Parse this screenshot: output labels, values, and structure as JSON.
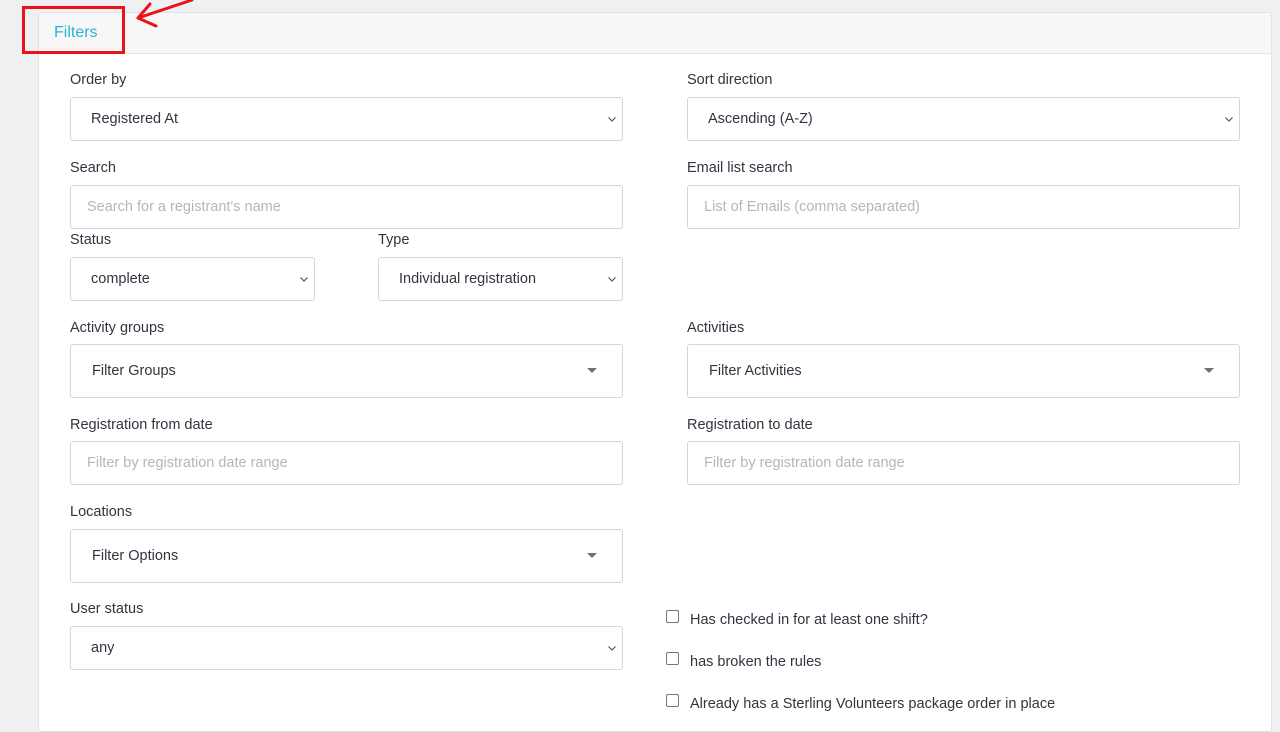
{
  "panel": {
    "title": "Filters"
  },
  "annotation": {
    "color": "#e8141a"
  },
  "order_by": {
    "label": "Order by",
    "value": "Registered At"
  },
  "sort_direction": {
    "label": "Sort direction",
    "value": "Ascending (A-Z)"
  },
  "search": {
    "label": "Search",
    "placeholder": "Search for a registrant's name"
  },
  "email_list_search": {
    "label": "Email list search",
    "placeholder": "List of Emails (comma separated)"
  },
  "status": {
    "label": "Status",
    "value": "complete"
  },
  "type": {
    "label": "Type",
    "value": "Individual registration"
  },
  "activity_groups": {
    "label": "Activity groups",
    "value": "Filter Groups"
  },
  "activities": {
    "label": "Activities",
    "value": "Filter Activities"
  },
  "registration_from_date": {
    "label": "Registration from date",
    "placeholder": "Filter by registration date range"
  },
  "registration_to_date": {
    "label": "Registration to date",
    "placeholder": "Filter by registration date range"
  },
  "locations": {
    "label": "Locations",
    "value": "Filter Options"
  },
  "user_status": {
    "label": "User status",
    "value": "any"
  },
  "checkboxes": [
    {
      "label": "Has checked in for at least one shift?"
    },
    {
      "label": "has broken the rules"
    },
    {
      "label": "Already has a Sterling Volunteers package order in place"
    }
  ],
  "colors": {
    "accent": "#2bb3d4",
    "border": "#cfd8e0",
    "placeholder": "#b0b7bf"
  }
}
